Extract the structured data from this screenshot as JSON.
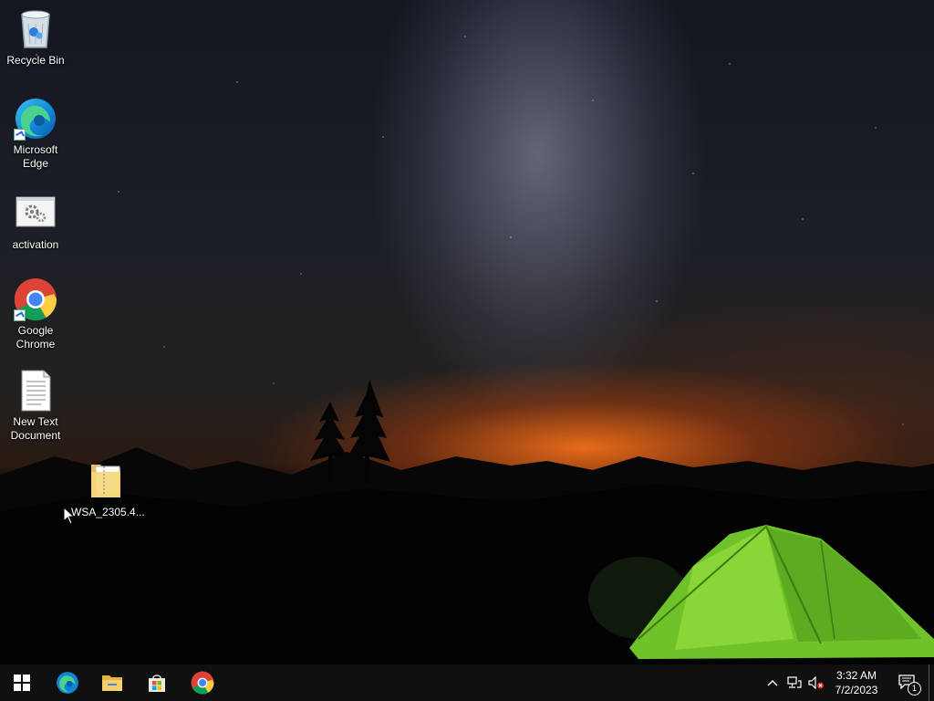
{
  "desktop": {
    "icons": [
      {
        "label": "Recycle Bin",
        "icon": "recycle-bin-icon"
      },
      {
        "label": "Microsoft Edge",
        "icon": "microsoft-edge-icon"
      },
      {
        "label": "activation",
        "icon": "activation-script-icon"
      },
      {
        "label": "Google Chrome",
        "icon": "google-chrome-icon"
      },
      {
        "label": "New Text Document",
        "icon": "text-document-icon"
      },
      {
        "label": "WSA_2305.4...",
        "icon": "folder-icon"
      }
    ]
  },
  "taskbar": {
    "start": "windows-start-icon",
    "pinned": [
      {
        "name": "Microsoft Edge",
        "icon": "edge-icon"
      },
      {
        "name": "File Explorer",
        "icon": "file-explorer-icon"
      },
      {
        "name": "Microsoft Store",
        "icon": "store-icon"
      },
      {
        "name": "Google Chrome",
        "icon": "chrome-icon"
      }
    ],
    "tray": {
      "icons": [
        "chevron-up-icon",
        "network-icon",
        "volume-muted-icon"
      ],
      "time": "3:32 AM",
      "date": "7/2/2023",
      "notification_count": "1"
    }
  },
  "colors": {
    "taskbar": "#101010",
    "sunset": "#f07a1c",
    "tent": "#8fd83a"
  }
}
